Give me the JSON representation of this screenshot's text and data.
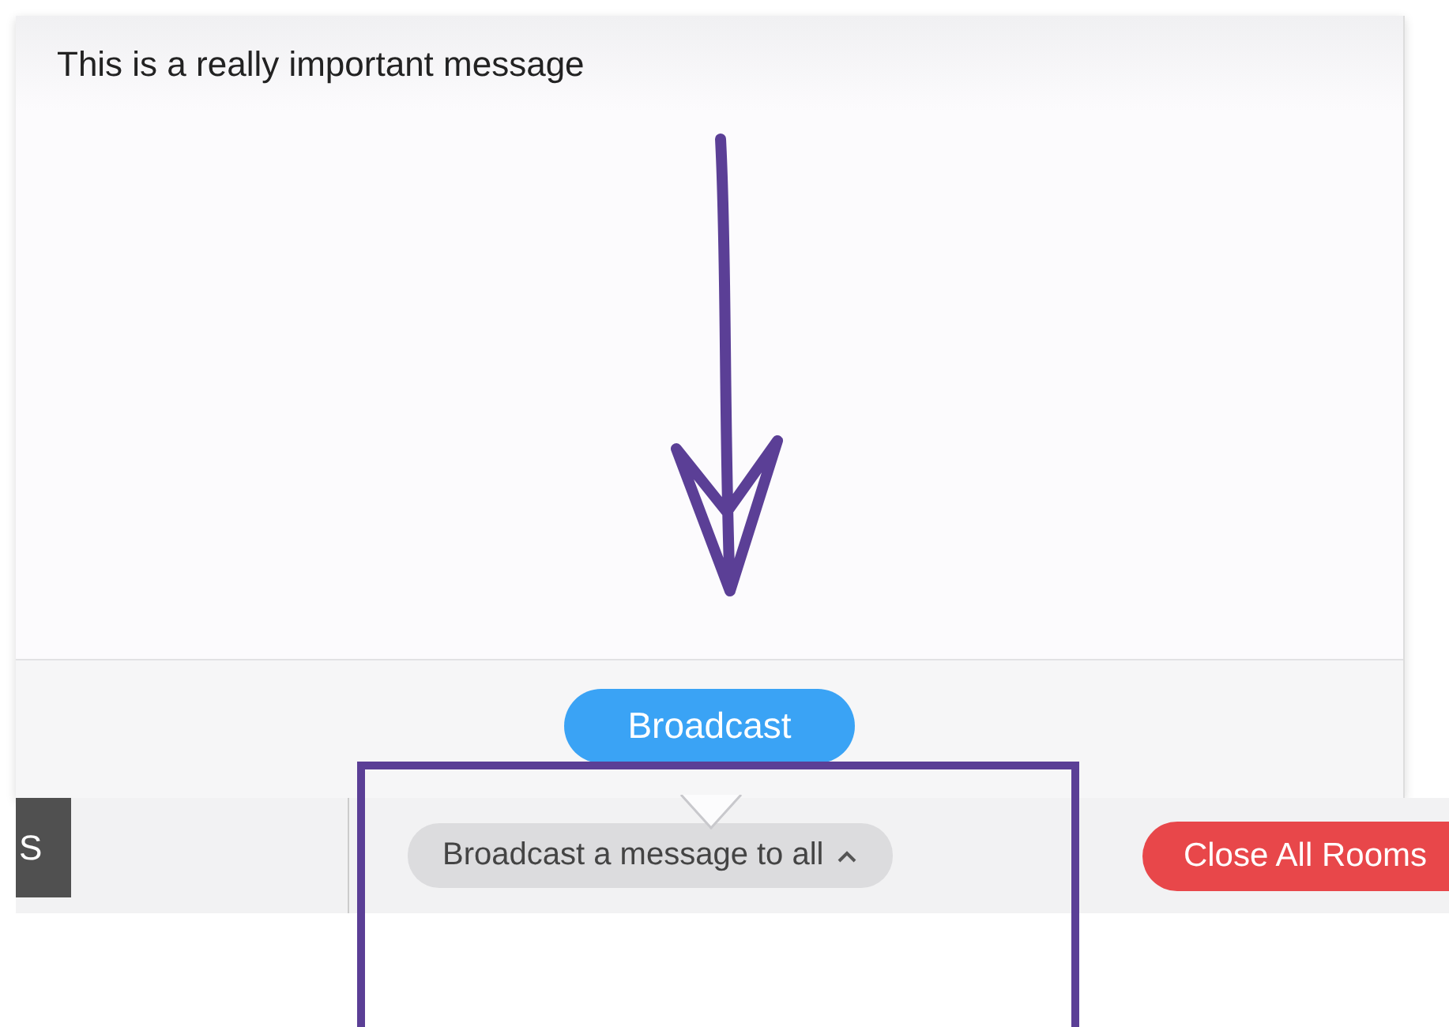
{
  "broadcast_popup": {
    "message": "This is a really important message",
    "button": "Broadcast"
  },
  "bottom_bar": {
    "left_button": "S",
    "broadcast_menu": {
      "label": "Broadcast a message to all",
      "expanded": true
    },
    "close_button": "Close All Rooms"
  }
}
